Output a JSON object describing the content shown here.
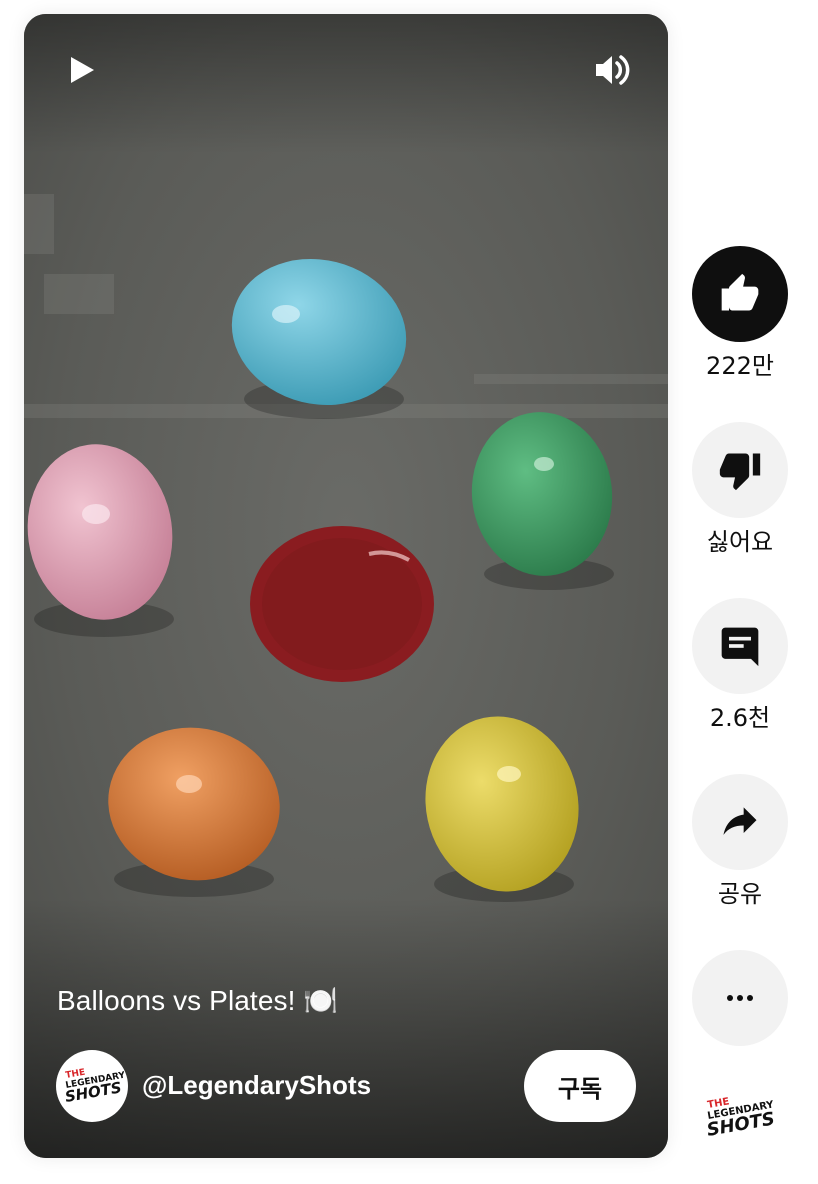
{
  "video": {
    "title": "Balloons vs Plates! 🍽️",
    "channel_handle": "@LegendaryShots",
    "subscribe_label": "구독",
    "controls": {
      "play_icon": "play-icon",
      "volume_icon": "volume-icon"
    },
    "scene_colors": {
      "floor": "#5b5c59",
      "balloon_blue": "#5fb9d1",
      "balloon_pink": "#e3a3b8",
      "balloon_green": "#3f9a63",
      "plate_red": "#8f1f23",
      "balloon_orange": "#d97d39",
      "balloon_yellow": "#d7c43a"
    }
  },
  "channel": {
    "logo_line1": "THE",
    "logo_line2": "LEGENDARY",
    "logo_line3": "SHOTS",
    "logo_color_red": "#d8262a",
    "logo_color_dark": "#111111"
  },
  "actions": {
    "like": {
      "label": "222만",
      "icon": "thumbs-up-icon"
    },
    "dislike": {
      "label": "싫어요",
      "icon": "thumbs-down-icon"
    },
    "comments": {
      "label": "2.6천",
      "icon": "comment-icon"
    },
    "share": {
      "label": "공유",
      "icon": "share-icon"
    },
    "more": {
      "icon": "more-horizontal-icon"
    }
  }
}
